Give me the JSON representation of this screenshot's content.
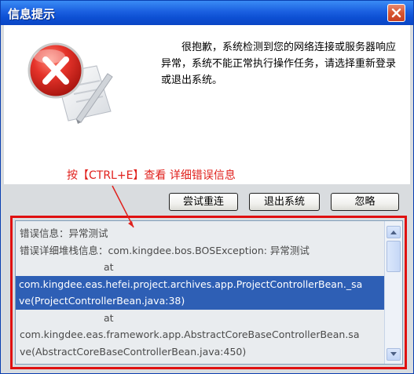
{
  "window": {
    "title": "信息提示"
  },
  "message": {
    "text": "很抱歉，系统检测到您的网络连接或服务器响应异常，系统不能正常执行操作任务，请选择重新登录或退出系统。"
  },
  "annotation": {
    "text": "按【CTRL+E】查看 详细错误信息",
    "color": "#e0201c"
  },
  "buttons": {
    "retry": "尝试重连",
    "exit": "退出系统",
    "ignore": "忽略"
  },
  "details": {
    "lines": [
      "错误信息：异常测试",
      "错误详细堆栈信息：com.kingdee.bos.BOSException: 异常测试",
      "at",
      "com.kingdee.eas.hefei.project.archives.app.ProjectControllerBean._sa",
      "ve(ProjectControllerBean.java:38)",
      "at",
      "com.kingdee.eas.framework.app.AbstractCoreBaseControllerBean.sa",
      "ve(AbstractCoreBaseControllerBean.java:450)"
    ]
  },
  "icons": {
    "error": "error-x-icon",
    "close": "close-icon"
  },
  "colors": {
    "titlebar": "#1a5fe0",
    "selection": "#2e5fb5",
    "highlight_frame": "#e01010"
  }
}
